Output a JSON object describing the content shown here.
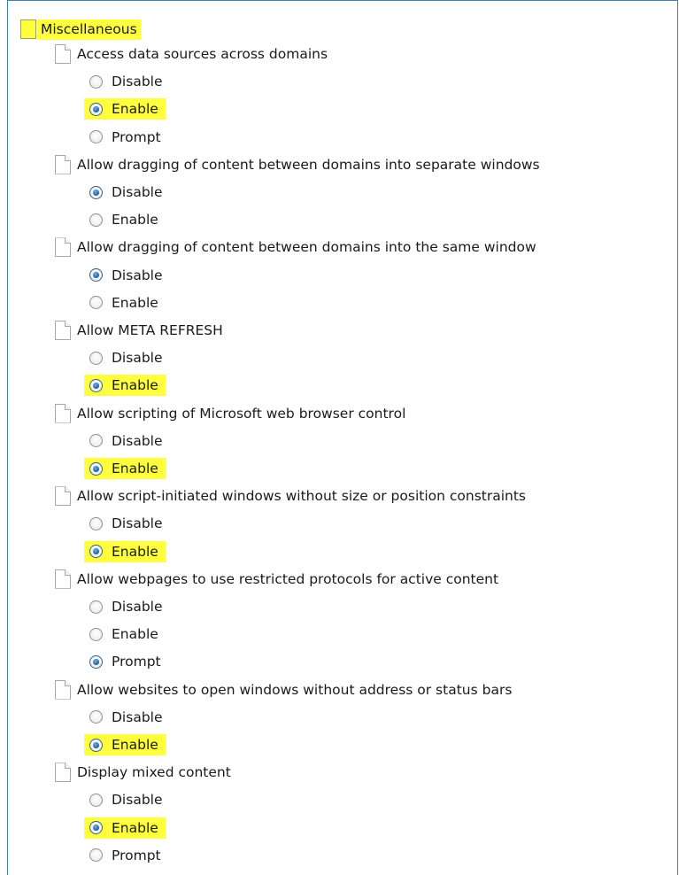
{
  "folder": {
    "label": "Miscellaneous",
    "icon": "folder-icon",
    "highlight_color": "#ffff40"
  },
  "settings": [
    {
      "label": "Access data sources across domains",
      "options": [
        {
          "label": "Disable",
          "checked": false,
          "highlighted": false
        },
        {
          "label": "Enable",
          "checked": true,
          "highlighted": true
        },
        {
          "label": "Prompt",
          "checked": false,
          "highlighted": false
        }
      ]
    },
    {
      "label": "Allow dragging of content between domains into separate windows",
      "options": [
        {
          "label": "Disable",
          "checked": true,
          "highlighted": false
        },
        {
          "label": "Enable",
          "checked": false,
          "highlighted": false
        }
      ]
    },
    {
      "label": "Allow dragging of content between domains into the same window",
      "options": [
        {
          "label": "Disable",
          "checked": true,
          "highlighted": false
        },
        {
          "label": "Enable",
          "checked": false,
          "highlighted": false
        }
      ]
    },
    {
      "label": "Allow META REFRESH",
      "options": [
        {
          "label": "Disable",
          "checked": false,
          "highlighted": false
        },
        {
          "label": "Enable",
          "checked": true,
          "highlighted": true
        }
      ]
    },
    {
      "label": "Allow scripting of Microsoft web browser control",
      "options": [
        {
          "label": "Disable",
          "checked": false,
          "highlighted": false
        },
        {
          "label": "Enable",
          "checked": true,
          "highlighted": true
        }
      ]
    },
    {
      "label": "Allow script-initiated windows without size or position constraints",
      "options": [
        {
          "label": "Disable",
          "checked": false,
          "highlighted": false
        },
        {
          "label": "Enable",
          "checked": true,
          "highlighted": true
        }
      ]
    },
    {
      "label": "Allow webpages to use restricted protocols for active content",
      "options": [
        {
          "label": "Disable",
          "checked": false,
          "highlighted": false
        },
        {
          "label": "Enable",
          "checked": false,
          "highlighted": false
        },
        {
          "label": "Prompt",
          "checked": true,
          "highlighted": false
        }
      ]
    },
    {
      "label": "Allow websites to open windows without address or status bars",
      "options": [
        {
          "label": "Disable",
          "checked": false,
          "highlighted": false
        },
        {
          "label": "Enable",
          "checked": true,
          "highlighted": true
        }
      ]
    },
    {
      "label": "Display mixed content",
      "options": [
        {
          "label": "Disable",
          "checked": false,
          "highlighted": false
        },
        {
          "label": "Enable",
          "checked": true,
          "highlighted": true
        },
        {
          "label": "Prompt",
          "checked": false,
          "highlighted": false
        }
      ]
    }
  ]
}
